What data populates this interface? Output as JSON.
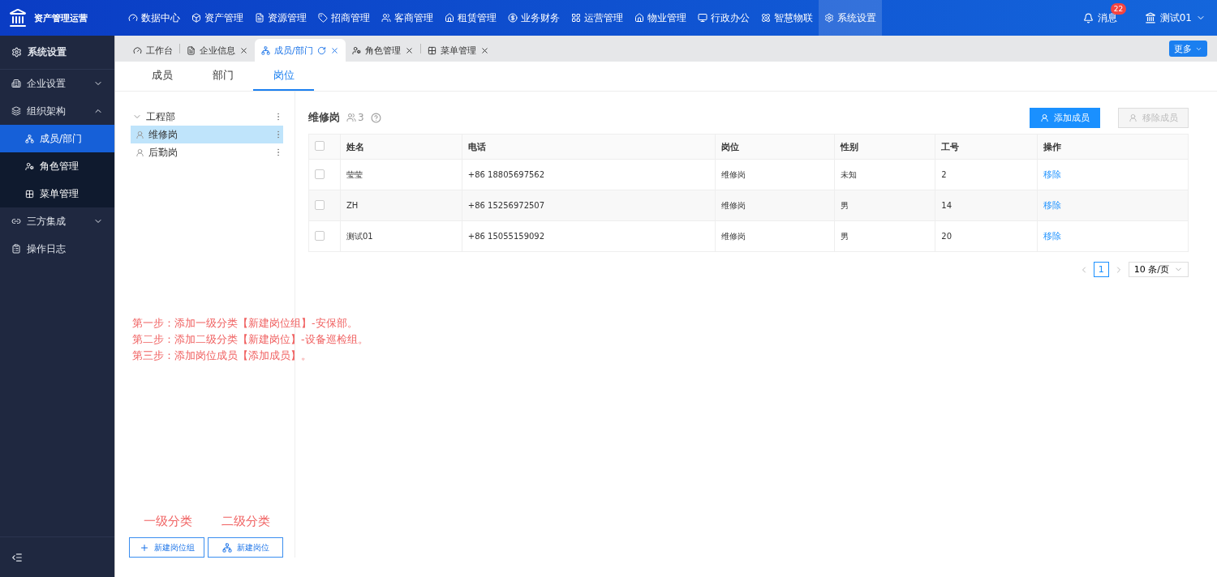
{
  "app": {
    "title": "资产管理运营"
  },
  "top_nav": [
    {
      "label": "数据中心",
      "selected": false
    },
    {
      "label": "资产管理",
      "selected": false
    },
    {
      "label": "资源管理",
      "selected": false
    },
    {
      "label": "招商管理",
      "selected": false
    },
    {
      "label": "客商管理",
      "selected": false
    },
    {
      "label": "租赁管理",
      "selected": false
    },
    {
      "label": "业务财务",
      "selected": false
    },
    {
      "label": "运营管理",
      "selected": false
    },
    {
      "label": "物业管理",
      "selected": false
    },
    {
      "label": "行政办公",
      "selected": false
    },
    {
      "label": "智慧物联",
      "selected": false
    },
    {
      "label": "系统设置",
      "selected": true
    }
  ],
  "messages": {
    "label": "消息",
    "badge": "22"
  },
  "user": {
    "name": "测试01"
  },
  "sidebar": {
    "title": "系统设置",
    "items": [
      {
        "label": "企业设置",
        "expanded": false
      },
      {
        "label": "组织架构",
        "expanded": true,
        "children": [
          {
            "label": "成员/部门",
            "selected": true
          },
          {
            "label": "角色管理",
            "selected": false
          },
          {
            "label": "菜单管理",
            "selected": false
          }
        ]
      },
      {
        "label": "三方集成",
        "expanded": false
      },
      {
        "label": "操作日志"
      }
    ]
  },
  "page_tabs": [
    {
      "label": "工作台",
      "selected": false,
      "closable": false
    },
    {
      "label": "企业信息",
      "selected": false,
      "closable": true
    },
    {
      "label": "成员/部门",
      "selected": true,
      "closable": true
    },
    {
      "label": "角色管理",
      "selected": false,
      "closable": true
    },
    {
      "label": "菜单管理",
      "selected": false,
      "closable": true
    }
  ],
  "more_button": "更多",
  "sub_tabs": [
    {
      "label": "成员",
      "selected": false
    },
    {
      "label": "部门",
      "selected": false
    },
    {
      "label": "岗位",
      "selected": true
    }
  ],
  "tree": [
    {
      "label": "工程部",
      "expanded": true,
      "selected": false,
      "children": [
        {
          "label": "维修岗",
          "selected": true
        },
        {
          "label": "后勤岗",
          "selected": false
        }
      ]
    }
  ],
  "annotations": [
    "第一步：添加一级分类【新建岗位组】-安保部。",
    "第二步：添加二级分类【新建岗位】-设备巡检组。",
    "第三步：添加岗位成员【添加成员】。"
  ],
  "category_labels": [
    "一级分类",
    "二级分类"
  ],
  "tree_buttons": [
    "新建岗位组",
    "新建岗位"
  ],
  "detail": {
    "title": "维修岗",
    "member_count": "3",
    "add_button": {
      "label": "添加成员",
      "disabled": false
    },
    "remove_button": {
      "label": "移除成员",
      "disabled": true
    }
  },
  "table": {
    "header_checked": false,
    "columns": [
      "姓名",
      "电话",
      "岗位",
      "性别",
      "工号",
      "操作"
    ],
    "rows": [
      {
        "checked": false,
        "cells": [
          "莹莹",
          "+86 18805697562",
          "维修岗",
          "未知",
          "2"
        ],
        "action": "移除"
      },
      {
        "checked": false,
        "cells": [
          "ZH",
          "+86 15256972507",
          "维修岗",
          "男",
          "14"
        ],
        "action": "移除"
      },
      {
        "checked": false,
        "cells": [
          "测试01",
          "+86 15055159092",
          "维修岗",
          "男",
          "20"
        ],
        "action": "移除"
      }
    ]
  },
  "pagination": {
    "pages": [
      {
        "label": "1",
        "selected": true
      }
    ],
    "page_size": "10 条/页"
  }
}
